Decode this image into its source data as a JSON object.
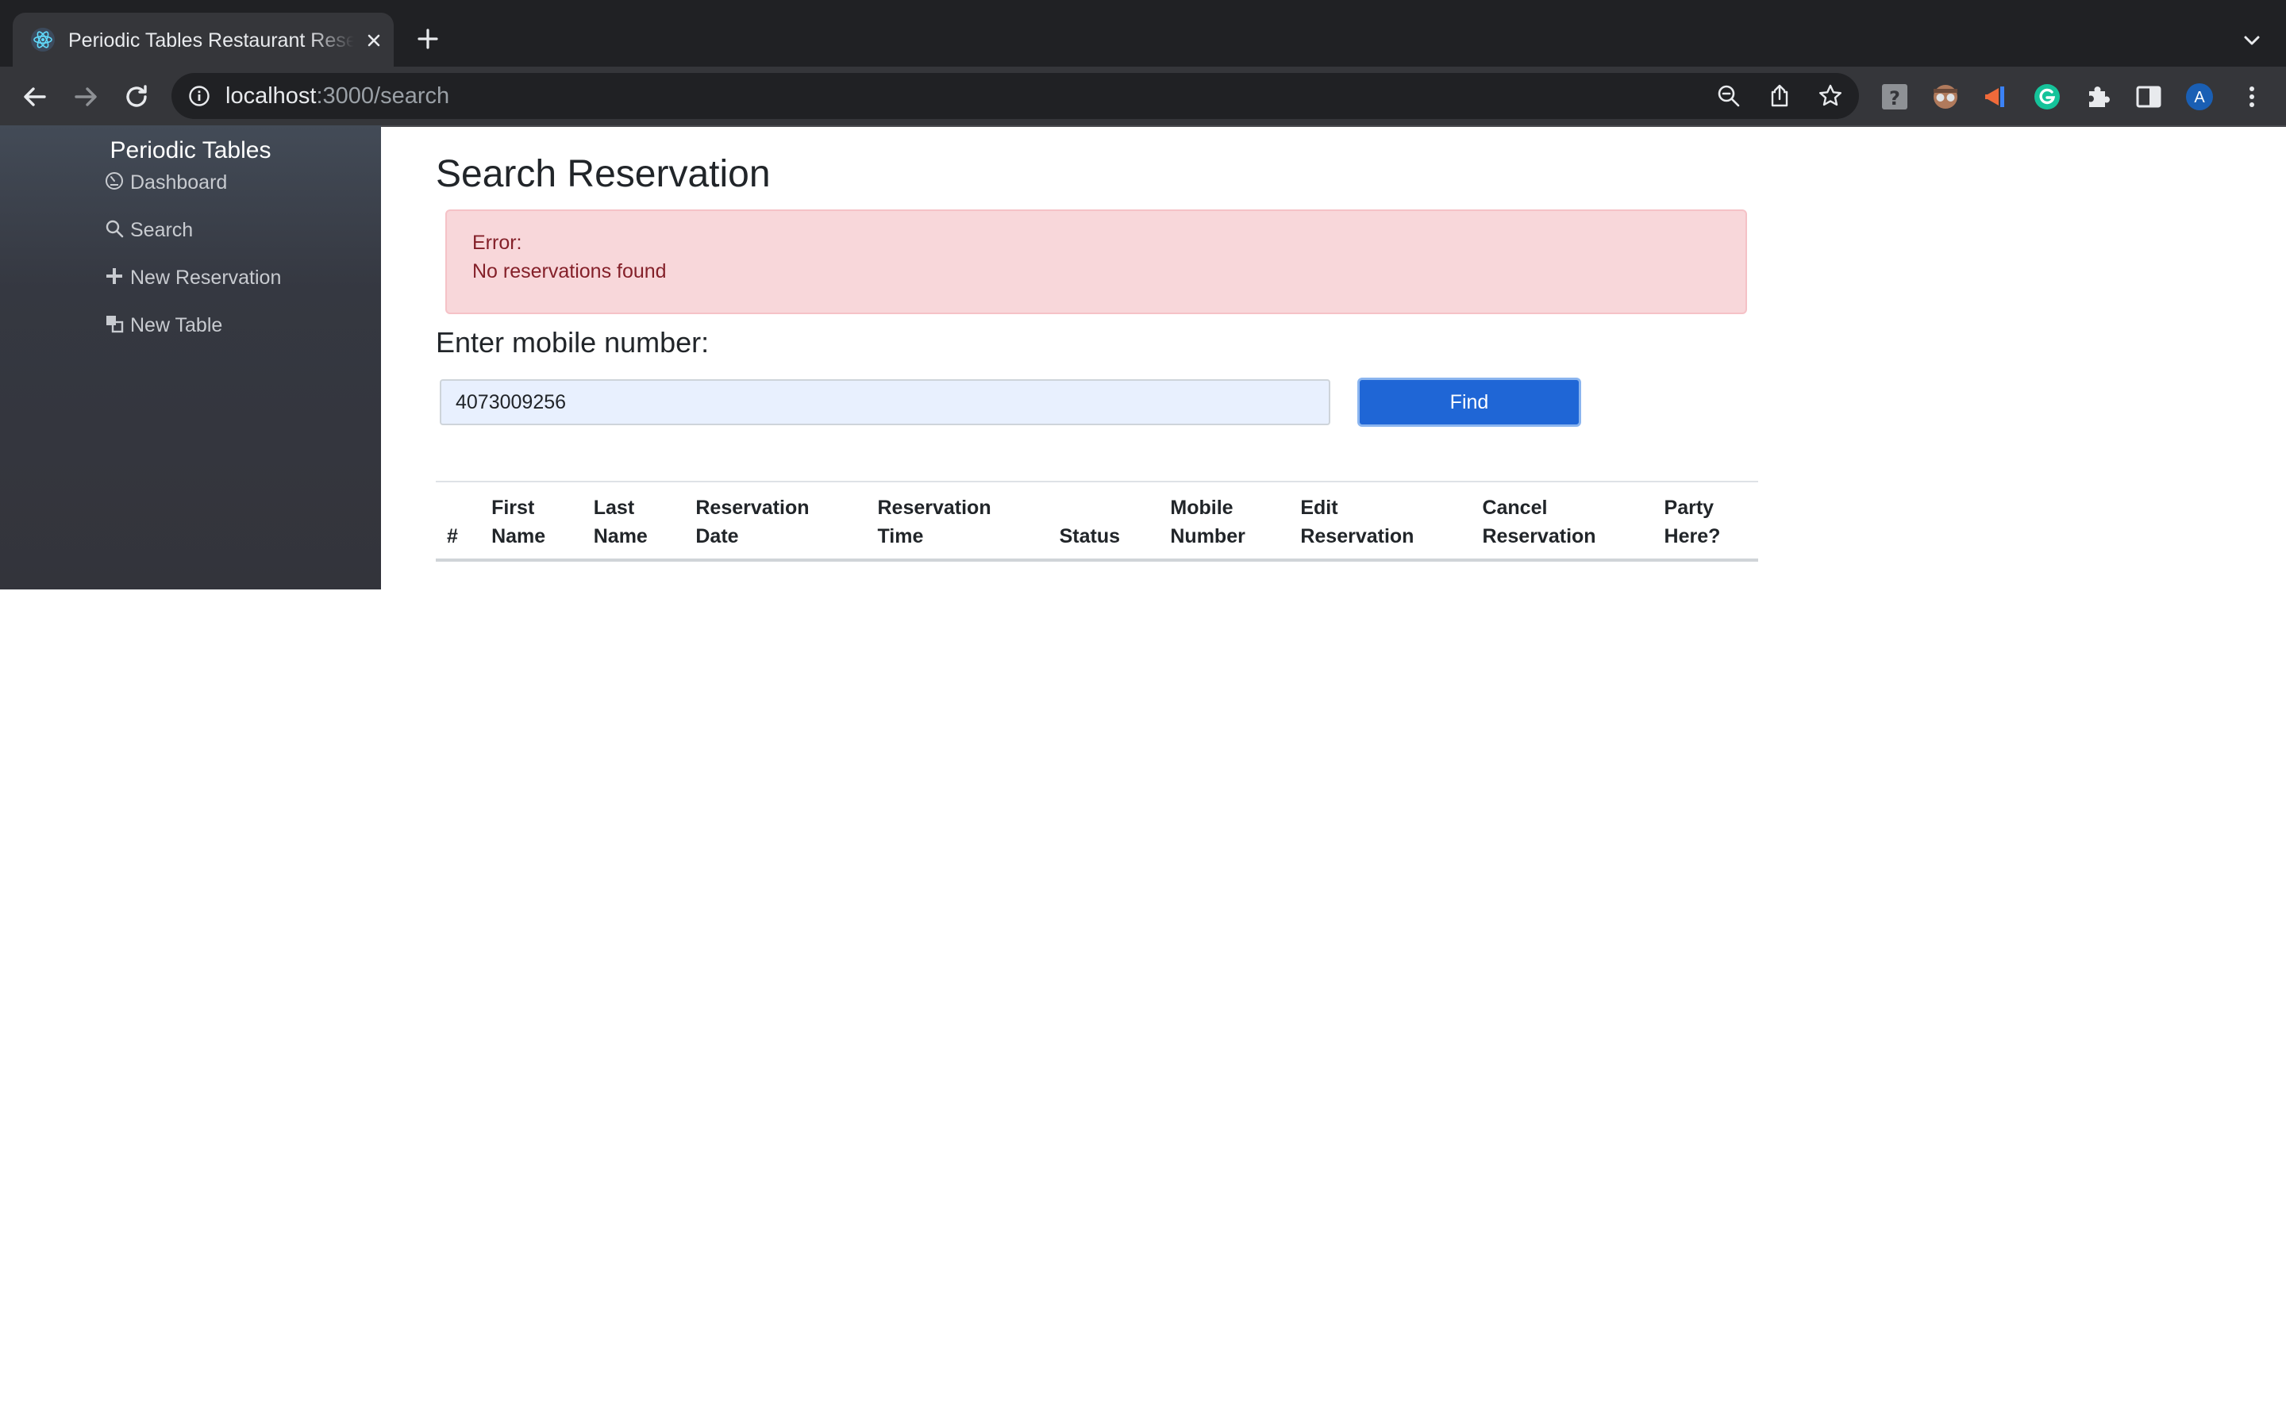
{
  "browser": {
    "tab_title": "Periodic Tables Restaurant Reservation",
    "url_host": "localhost",
    "url_path": ":3000/search",
    "profile_initial": "A"
  },
  "sidebar": {
    "brand": "Periodic Tables",
    "items": [
      {
        "label": "Dashboard",
        "icon": "dashboard-icon"
      },
      {
        "label": "Search",
        "icon": "search-icon"
      },
      {
        "label": "New Reservation",
        "icon": "plus-icon"
      },
      {
        "label": "New Table",
        "icon": "table-icon"
      }
    ]
  },
  "main": {
    "title": "Search Reservation",
    "error": {
      "heading": "Error:",
      "message": "No reservations found"
    },
    "mobile_label": "Enter mobile number:",
    "mobile_value": "4073009256",
    "find_label": "Find",
    "table": {
      "columns": [
        [
          "#"
        ],
        [
          "First",
          "Name"
        ],
        [
          "Last",
          "Name"
        ],
        [
          "Reservation",
          "Date"
        ],
        [
          "Reservation",
          "Time"
        ],
        [
          "Status"
        ],
        [
          "Mobile",
          "Number"
        ],
        [
          "Edit",
          "Reservation"
        ],
        [
          "Cancel",
          "Reservation"
        ],
        [
          "Party",
          "Here?"
        ]
      ],
      "rows": []
    }
  },
  "colors": {
    "sidebar_bg": "#33343b",
    "alert_bg": "#f8d7da",
    "alert_text": "#842029",
    "primary": "#1f66d6",
    "chrome_bg": "#202124"
  }
}
